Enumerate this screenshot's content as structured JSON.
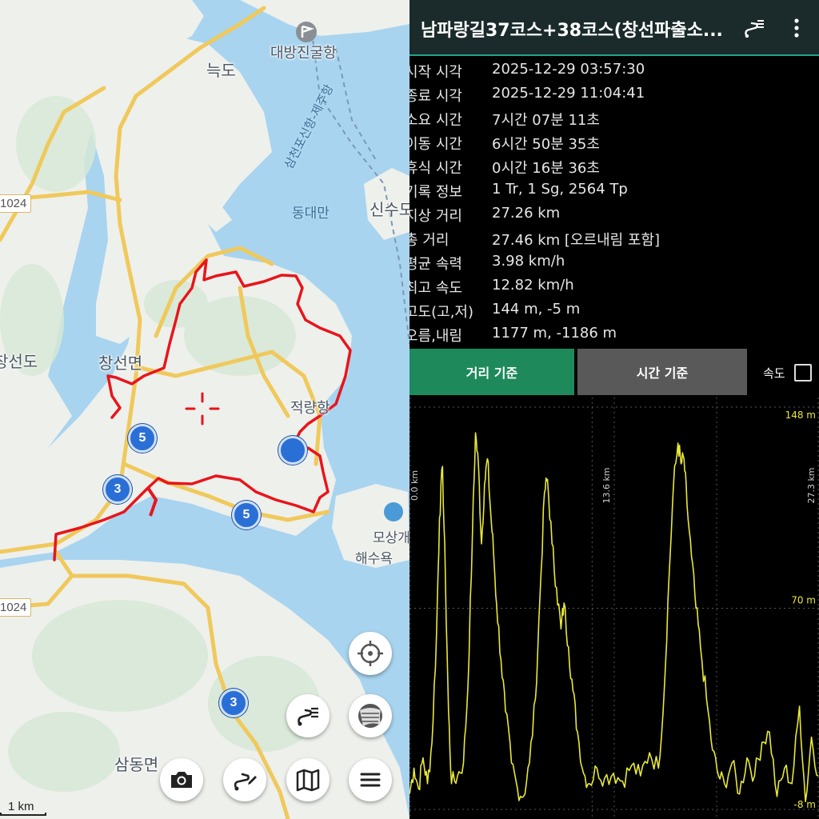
{
  "map": {
    "labels": {
      "daebang": "대방진굴항",
      "neukdo": "늑도",
      "ferry_route": "삼천포신항-제주항",
      "dongdaeman": "동대만",
      "sinsu": "신수도",
      "changseon_myeon": "창선면",
      "changseon_do": "창선도",
      "jeokryang": "적량항",
      "mosang": "모상개",
      "beach": "해수욕",
      "samdong": "삼동면",
      "road_1024_top": "1024",
      "road_1024_bottom": "1024"
    },
    "shields": {
      "s1": "5",
      "s2": "3",
      "s3": "5",
      "s4": "3"
    },
    "scale": "1 km",
    "buttons": {
      "locate": "crosshair-locate-icon",
      "layers": "map-layer-icon",
      "track_list": "track-list-icon",
      "camera": "camera-icon",
      "track_edit": "track-edit-icon",
      "map": "folded-map-icon",
      "menu": "hamburger-menu-icon"
    },
    "colors": {
      "track": "#e8151b",
      "water": "#a8d4ef",
      "land": "#eef0ec",
      "road": "#f7d77a"
    }
  },
  "appbar": {
    "title": "남파랑길37코스+38코스(창선파출소...",
    "list_icon": "track-list-icon",
    "more_icon": "more-vertical-icon"
  },
  "stats": [
    {
      "label": "시작 시각",
      "value": "2025-12-29 03:57:30"
    },
    {
      "label": "종료 시각",
      "value": "2025-12-29 11:04:41"
    },
    {
      "label": "소요 시간",
      "value": "7시간 07분 11초"
    },
    {
      "label": "이동 시간",
      "value": "6시간 50분 35초"
    },
    {
      "label": "휴식 시간",
      "value": "0시간 16분 36초"
    },
    {
      "label": "기록 정보",
      "value": "1 Tr, 1 Sg, 2564 Tp"
    },
    {
      "label": "지상 거리",
      "value": "27.26 km"
    },
    {
      "label": "총 거리",
      "value": "27.46 km [오르내림 포함]"
    },
    {
      "label": "평균 속력",
      "value": "3.98 km/h"
    },
    {
      "label": "최고 속도",
      "value": "12.82 km/h"
    },
    {
      "label": "고도(고,저)",
      "value": "144 m, -5 m"
    },
    {
      "label": "오름,내림",
      "value": "1177 m, -1186 m"
    }
  ],
  "tabs": {
    "distance": "거리 기준",
    "time": "시간 기준",
    "speed": "속도",
    "speed_checked": false
  },
  "chart_data": {
    "type": "line",
    "series": [
      {
        "values": [
          [
            0.0,
            -2
          ],
          [
            0.3,
            8
          ],
          [
            0.6,
            0
          ],
          [
            0.9,
            12
          ],
          [
            1.2,
            2
          ],
          [
            1.5,
            18
          ],
          [
            1.8,
            60
          ],
          [
            2.0,
            105
          ],
          [
            2.2,
            125
          ],
          [
            2.4,
            80
          ],
          [
            2.6,
            30
          ],
          [
            2.8,
            2
          ],
          [
            3.2,
            5
          ],
          [
            3.6,
            10
          ],
          [
            3.9,
            40
          ],
          [
            4.2,
            100
          ],
          [
            4.4,
            138
          ],
          [
            4.6,
            125
          ],
          [
            4.8,
            95
          ],
          [
            5.0,
            118
          ],
          [
            5.2,
            128
          ],
          [
            5.4,
            108
          ],
          [
            5.6,
            92
          ],
          [
            5.8,
            72
          ],
          [
            6.1,
            50
          ],
          [
            6.4,
            30
          ],
          [
            6.8,
            10
          ],
          [
            7.2,
            0
          ],
          [
            7.6,
            -3
          ],
          [
            8.0,
            10
          ],
          [
            8.4,
            35
          ],
          [
            8.7,
            75
          ],
          [
            9.0,
            115
          ],
          [
            9.2,
            120
          ],
          [
            9.5,
            95
          ],
          [
            9.8,
            78
          ],
          [
            10.1,
            62
          ],
          [
            10.3,
            72
          ],
          [
            10.6,
            55
          ],
          [
            10.9,
            38
          ],
          [
            11.2,
            22
          ],
          [
            11.6,
            6
          ],
          [
            12.0,
            2
          ],
          [
            12.5,
            8
          ],
          [
            13.0,
            4
          ],
          [
            13.6,
            6
          ],
          [
            14.2,
            3
          ],
          [
            14.8,
            9
          ],
          [
            15.4,
            5
          ],
          [
            16.0,
            14
          ],
          [
            16.6,
            8
          ],
          [
            17.0,
            40
          ],
          [
            17.3,
            82
          ],
          [
            17.6,
            118
          ],
          [
            17.9,
            134
          ],
          [
            18.1,
            126
          ],
          [
            18.3,
            128
          ],
          [
            18.5,
            110
          ],
          [
            18.8,
            90
          ],
          [
            19.1,
            70
          ],
          [
            19.4,
            55
          ],
          [
            19.8,
            35
          ],
          [
            20.2,
            15
          ],
          [
            20.6,
            5
          ],
          [
            21.0,
            2
          ],
          [
            21.5,
            10
          ],
          [
            22.0,
            -2
          ],
          [
            22.5,
            12
          ],
          [
            23.0,
            5
          ],
          [
            23.5,
            18
          ],
          [
            24.0,
            22
          ],
          [
            24.5,
            -3
          ],
          [
            25.0,
            8
          ],
          [
            25.5,
            2
          ],
          [
            26.0,
            32
          ],
          [
            26.4,
            -5
          ],
          [
            26.8,
            20
          ],
          [
            27.26,
            5
          ]
        ]
      }
    ],
    "ylim": [
      -8,
      148
    ],
    "xlim": [
      0,
      27.3
    ],
    "y_tick_labels": [
      "148 m",
      "70 m",
      "-8 m"
    ],
    "x_markers": [
      "0.0 km",
      "13.6 km",
      "27.3 km"
    ],
    "grid": true,
    "line_color": "#e8e83a"
  }
}
